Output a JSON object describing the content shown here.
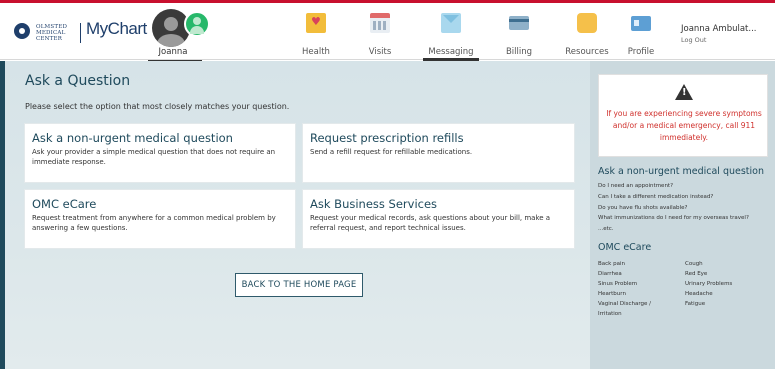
{
  "header": {
    "logo_text": "OLMSTED MEDICAL CENTER",
    "app_name": "MyChart",
    "user_tab": "Joanna",
    "nav": [
      {
        "label": "Health",
        "icon": "health-icon"
      },
      {
        "label": "Visits",
        "icon": "calendar-icon"
      },
      {
        "label": "Messaging",
        "icon": "envelope-icon"
      },
      {
        "label": "Billing",
        "icon": "credit-card-icon"
      },
      {
        "label": "Resources",
        "icon": "lightbulb-icon"
      },
      {
        "label": "Profile",
        "icon": "id-card-icon"
      }
    ],
    "account_name": "Joanna Ambulat...",
    "logout": "Log Out"
  },
  "main": {
    "title": "Ask a Question",
    "subtitle": "Please select the option that most closely matches your question.",
    "cards": [
      {
        "title": "Ask a non-urgent medical question",
        "desc": "Ask your provider a simple medical question that does not require an immediate response."
      },
      {
        "title": "Request prescription refills",
        "desc": "Send a refill request for refillable medications."
      },
      {
        "title": "OMC eCare",
        "desc": "Request treatment from anywhere for a common medical problem by answering a few questions."
      },
      {
        "title": "Ask Business Services",
        "desc": "Request your medical records, ask questions about your bill, make a referral request, and report technical issues."
      }
    ],
    "back_button": "BACK TO THE HOME PAGE"
  },
  "sidebar": {
    "alert": "If you are experiencing severe symptoms and/or a medical emergency, call 911 immediately.",
    "nonurgent_heading": "Ask a non-urgent medical question",
    "nonurgent_links": [
      "Do I need an appointment?",
      "Can I take a different medication instead?",
      "Do you have flu shots available?",
      "What immunizations do I need for my overseas travel?",
      "...etc."
    ],
    "ecare_heading": "OMC eCare",
    "ecare_col1": [
      "Back pain",
      "Diarrhea",
      "Sinus Problem",
      "Heartburn",
      "Vaginal Discharge /",
      "Irritation"
    ],
    "ecare_col2": [
      "Cough",
      "Red Eye",
      "Urinary Problems",
      "Headache",
      "Fatigue"
    ]
  },
  "colors": {
    "accent": "#1f4a5c",
    "alert": "#d0312d",
    "top_bar": "#c8102e"
  }
}
